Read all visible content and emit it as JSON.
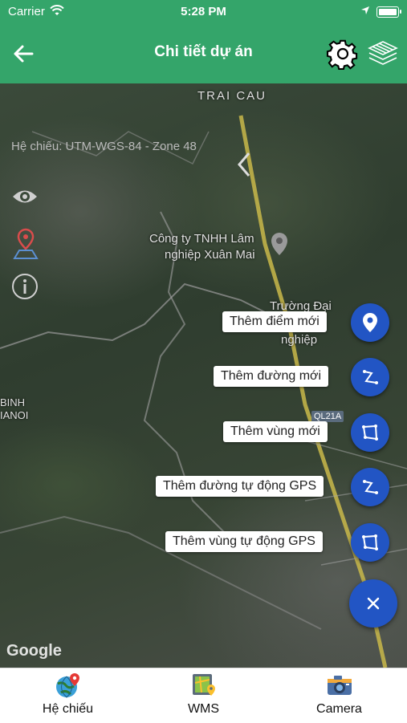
{
  "status_bar": {
    "carrier": "Carrier",
    "time": "5:28 PM"
  },
  "navbar": {
    "title": "Chi tiết dự án"
  },
  "map": {
    "coordinate_system": "Hệ chiếu: UTM-WGS-84 - Zone 48",
    "places": {
      "trai_cau": "TRAI CAU",
      "company_line1": "Công ty TNHH Lâm",
      "company_line2": "nghiệp Xuân Mai",
      "school_line1": "Trường Đại",
      "school_line2": "nghiệp",
      "road": "QL21A",
      "binh": "BINH",
      "hanoi": "IANOI"
    },
    "attribution": "Google"
  },
  "actions": [
    {
      "label": "Thêm điểm mới",
      "icon": "location-pin-icon"
    },
    {
      "label": "Thêm đường mới",
      "icon": "polyline-icon"
    },
    {
      "label": "Thêm vùng mới",
      "icon": "polygon-icon"
    },
    {
      "label": "Thêm đường tự động GPS",
      "icon": "polyline-icon"
    },
    {
      "label": "Thêm vùng tự động GPS",
      "icon": "polygon-icon"
    }
  ],
  "tabs": [
    {
      "label": "Hệ chiếu",
      "icon": "globe-pin-icon"
    },
    {
      "label": "WMS",
      "icon": "map-layers-icon"
    },
    {
      "label": "Camera",
      "icon": "camera-icon"
    }
  ],
  "colors": {
    "header": "#34a56a",
    "fab": "#2255c4"
  }
}
